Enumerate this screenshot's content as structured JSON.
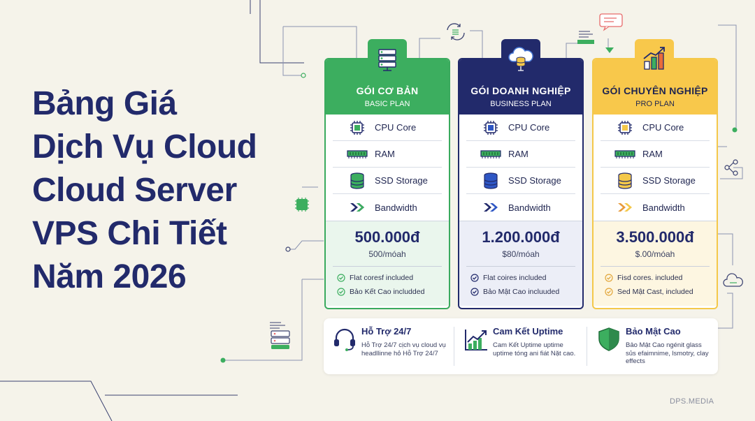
{
  "headline": {
    "lines": [
      "Bảng Giá",
      "Dịch Vụ Cloud",
      "Cloud Server",
      "VPS Chi Tiết",
      "Năm 2026"
    ]
  },
  "colors": {
    "navy": "#222a6b",
    "green": "#3cae5f",
    "yellow": "#f8c84b",
    "background": "#f5f3ea"
  },
  "plans": [
    {
      "name": "GÓI CƠ BẢN",
      "subtitle": "BASIC PLAN",
      "icon": "server-rack-icon",
      "features": [
        {
          "icon": "cpu-chip-icon",
          "label": "CPU Core"
        },
        {
          "icon": "ram-module-icon",
          "label": "RAM"
        },
        {
          "icon": "database-stack-icon",
          "label": "SSD Storage"
        },
        {
          "icon": "double-chevron-icon",
          "label": "Bandwidth"
        }
      ],
      "price": "500.000đ",
      "period": "500/móah",
      "includes": [
        "Flat coresf included",
        "Bảo Kết Cao  includded"
      ]
    },
    {
      "name": "GÓI DOANH NGHIỆP",
      "subtitle": "BUSINESS PLAN",
      "icon": "cloud-database-icon",
      "features": [
        {
          "icon": "cpu-chip-icon",
          "label": "CPU Core"
        },
        {
          "icon": "ram-module-icon",
          "label": "RAM"
        },
        {
          "icon": "database-stack-icon",
          "label": "SSD Storage"
        },
        {
          "icon": "double-chevron-icon",
          "label": "Bandwidth"
        }
      ],
      "price": "1.200.000đ",
      "period": "$80/móah",
      "includes": [
        "Flat coires included",
        "Bảo Mật Cao incluuded"
      ]
    },
    {
      "name": "GÓI CHUYÊN NGHIỆP",
      "subtitle": "PRO PLAN",
      "icon": "growth-chart-icon",
      "features": [
        {
          "icon": "cpu-chip-icon",
          "label": "CPU Core"
        },
        {
          "icon": "ram-module-icon",
          "label": "RAM"
        },
        {
          "icon": "database-stack-icon",
          "label": "SSD Storage"
        },
        {
          "icon": "double-chevron-icon",
          "label": "Bandwidth"
        }
      ],
      "price": "3.500.000đ",
      "period": "$.00/móah",
      "includes": [
        "Fisd cores. included",
        "Sed Mật Cast, included"
      ]
    }
  ],
  "benefits": [
    {
      "icon": "headset-icon",
      "title": "Hỗ Trợ 24/7",
      "text": "Hỗ Trợ 24/7 cịch vụ cloud vụ headllinne hỏ Hỗ Trợ 24/7"
    },
    {
      "icon": "uptime-chart-icon",
      "title": "Cam Kết Uptime",
      "text": "Cam Kết Uptime uptime uptime tóng ani fiát Nặt cao."
    },
    {
      "icon": "shield-icon",
      "title": "Bảo Mật Cao",
      "text": "Bảo Mật Cao ngénit glass sủs efaimnime, lsmotry, clay effects"
    }
  ],
  "brand": "DPS.MEDIA"
}
